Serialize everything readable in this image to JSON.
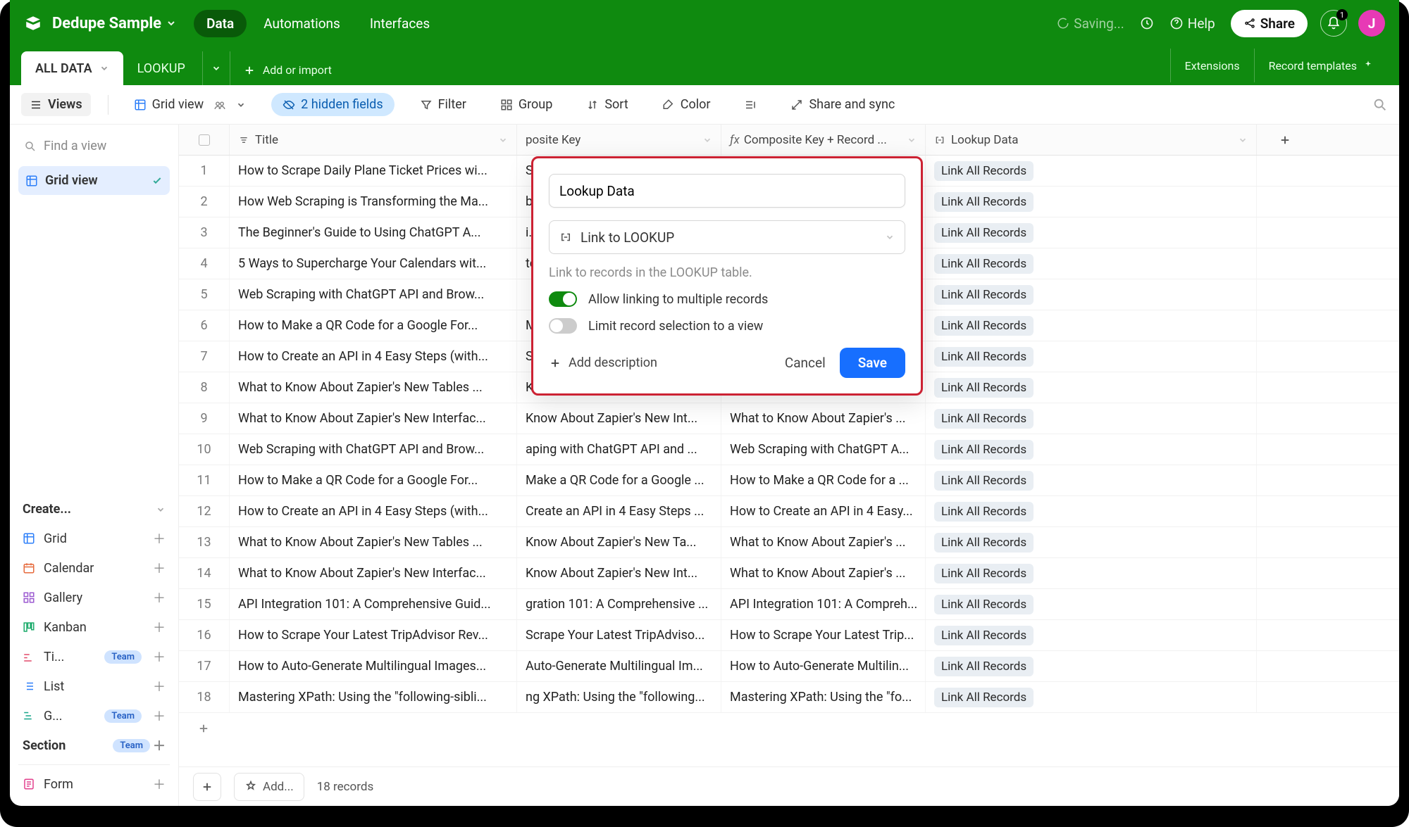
{
  "header": {
    "base_name": "Dedupe Sample",
    "nav": {
      "data": "Data",
      "automations": "Automations",
      "interfaces": "Interfaces"
    },
    "saving": "Saving...",
    "help": "Help",
    "share": "Share",
    "notif_count": "1",
    "avatar_initial": "J"
  },
  "tabs": {
    "all_data": "ALL DATA",
    "lookup": "LOOKUP",
    "add_import": "Add or import",
    "extensions": "Extensions",
    "record_templates": "Record templates"
  },
  "toolbar": {
    "views": "Views",
    "grid_view": "Grid view",
    "hidden_fields": "2 hidden fields",
    "filter": "Filter",
    "group": "Group",
    "sort": "Sort",
    "color": "Color",
    "share_sync": "Share and sync"
  },
  "sidebar": {
    "find_placeholder": "Find a view",
    "grid_view": "Grid view",
    "create": "Create...",
    "items": {
      "grid": "Grid",
      "calendar": "Calendar",
      "gallery": "Gallery",
      "kanban": "Kanban",
      "timeline": "Ti...",
      "list": "List",
      "gantt": "G...",
      "team": "Team"
    },
    "section": "Section",
    "form": "Form"
  },
  "columns": {
    "title": "Title",
    "composite": "posite Key",
    "composite_record": "Composite Key + Record ...",
    "lookup_data": "Lookup Data"
  },
  "rows": [
    {
      "n": "1",
      "title": "How to Scrape Daily Plane Ticket Prices wi...",
      "ck": "S…",
      "ckr": "",
      "chip": "Link All Records"
    },
    {
      "n": "2",
      "title": "How Web Scraping is Transforming the Ma...",
      "ck": "b…",
      "ckr": "",
      "chip": "Link All Records"
    },
    {
      "n": "3",
      "title": "The Beginner's Guide to Using ChatGPT A...",
      "ck": "i…",
      "ckr": "",
      "chip": "Link All Records"
    },
    {
      "n": "4",
      "title": "5 Ways to Supercharge Your Calendars wit...",
      "ck": "to…",
      "ckr": "",
      "chip": "Link All Records"
    },
    {
      "n": "5",
      "title": "Web Scraping with ChatGPT API and Brow...",
      "ck": "",
      "ckr": "",
      "chip": "Link All Records"
    },
    {
      "n": "6",
      "title": "How to Make a QR Code for a Google For...",
      "ck": "M…",
      "ckr": "",
      "chip": "Link All Records"
    },
    {
      "n": "7",
      "title": "How to Create an API in 4 Easy Steps (with...",
      "ck": "S…",
      "ckr": "",
      "chip": "Link All Records"
    },
    {
      "n": "8",
      "title": "What to Know About Zapier's New Tables ...",
      "ck": "K…",
      "ckr": "",
      "chip": "Link All Records"
    },
    {
      "n": "9",
      "title": "What to Know About Zapier's New Interfac...",
      "ck": "Know About Zapier's New Int...",
      "ckr": "What to Know About Zapier's ...",
      "chip": "Link All Records"
    },
    {
      "n": "10",
      "title": "Web Scraping with ChatGPT API and Brow...",
      "ck": "aping with ChatGPT API and ...",
      "ckr": "Web Scraping with ChatGPT A...",
      "chip": "Link All Records"
    },
    {
      "n": "11",
      "title": "How to Make a QR Code for a Google For...",
      "ck": "Make a QR Code for a Google ...",
      "ckr": "How to Make a QR Code for a ...",
      "chip": "Link All Records"
    },
    {
      "n": "12",
      "title": "How to Create an API in 4 Easy Steps (with...",
      "ck": "Create an API in 4 Easy Steps ...",
      "ckr": "How to Create an API in 4 Easy...",
      "chip": "Link All Records"
    },
    {
      "n": "13",
      "title": "What to Know About Zapier's New Tables ...",
      "ck": "Know About Zapier's New Ta...",
      "ckr": "What to Know About Zapier's ...",
      "chip": "Link All Records"
    },
    {
      "n": "14",
      "title": "What to Know About Zapier's New Interfac...",
      "ck": "Know About Zapier's New Int...",
      "ckr": "What to Know About Zapier's ...",
      "chip": "Link All Records"
    },
    {
      "n": "15",
      "title": "API Integration 101: A Comprehensive Guid...",
      "ck": "gration 101: A Comprehensive ...",
      "ckr": "API Integration 101: A Compreh...",
      "chip": "Link All Records"
    },
    {
      "n": "16",
      "title": "How to Scrape Your Latest TripAdvisor Rev...",
      "ck": "Scrape Your Latest TripAdviso...",
      "ckr": "How to Scrape Your Latest Trip...",
      "chip": "Link All Records"
    },
    {
      "n": "17",
      "title": "How to Auto-Generate Multilingual Images...",
      "ck": "Auto-Generate Multilingual Im...",
      "ckr": "How to Auto-Generate Multilin...",
      "chip": "Link All Records"
    },
    {
      "n": "18",
      "title": "Mastering XPath: Using the \"following-sibli...",
      "ck": "ng XPath: Using the \"following...",
      "ckr": "Mastering XPath: Using the \"fo...",
      "chip": "Link All Records"
    }
  ],
  "footer": {
    "add": "Add...",
    "count": "18 records"
  },
  "popover": {
    "field_name": "Lookup Data",
    "link_to": "Link to LOOKUP",
    "hint": "Link to records in the LOOKUP table.",
    "allow_multi": "Allow linking to multiple records",
    "limit_view": "Limit record selection to a view",
    "add_desc": "Add description",
    "cancel": "Cancel",
    "save": "Save"
  }
}
